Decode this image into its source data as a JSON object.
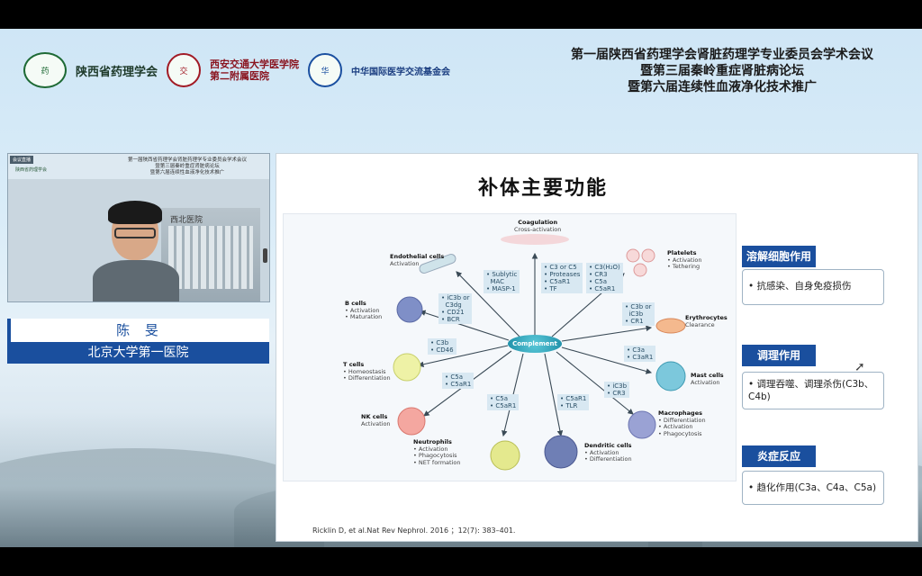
{
  "header": {
    "logos": [
      {
        "icon": "pharmacology-society-logo",
        "name": "陕西省药理学会"
      },
      {
        "icon": "xjtu-medical-logo",
        "name_line1": "西安交通大学医学院",
        "name_line2": "第二附属医院"
      },
      {
        "icon": "china-medical-exchange-logo",
        "name": "中华国际医学交流基金会"
      }
    ],
    "conference_lines": [
      "第一届陕西省药理学会肾脏药理学专业委员会学术会议",
      "暨第三届秦岭重症肾脏病论坛",
      "暨第六届连续性血液净化技术推广"
    ]
  },
  "video": {
    "badge": "会议直播",
    "title_lines": [
      "第一届陕西省药理学会肾脏药理学专业委员会学术会议",
      "暨第三届秦岭重症肾脏病论坛",
      "暨第六届连续性血液净化技术推广"
    ],
    "logo_text": "陕西省药理学会",
    "building_text": "西北医院"
  },
  "speaker": {
    "name": "陈 旻",
    "hospital": "北京大学第一医院"
  },
  "slide": {
    "title": "补体主要功能",
    "citation": "Ricklin D, et al.Nat Rev Nephrol. 2016 ；12(7): 383–401.",
    "functions": [
      {
        "heading": "溶解细胞作用",
        "text": "• 抗感染、自身免疫损伤"
      },
      {
        "heading": "调理作用",
        "text": "• 调理吞噬、调理杀伤(C3b、C4b)"
      },
      {
        "heading": "炎症反应",
        "text": "• 趋化作用(C3a、C4a、C5a)"
      }
    ],
    "diagram": {
      "center": "Complement",
      "cells": [
        {
          "title": "Coagulation",
          "sub": "Cross-activation"
        },
        {
          "title": "Endothelial cells",
          "sub": "Activation"
        },
        {
          "title": "Platelets",
          "sub": "• Activation\n• Tethering"
        },
        {
          "title": "B cells",
          "sub": "• Activation\n• Maturation"
        },
        {
          "title": "Erythrocytes",
          "sub": "Clearance"
        },
        {
          "title": "T cells",
          "sub": "• Homeostasis\n• Differentiation"
        },
        {
          "title": "Mast cells",
          "sub": "Activation"
        },
        {
          "title": "NK cells",
          "sub": "Activation"
        },
        {
          "title": "Macrophages",
          "sub": "• Differentiation\n• Activation\n• Phagocytosis"
        },
        {
          "title": "Neutrophils",
          "sub": "• Activation\n• Phagocytosis\n• NET formation"
        },
        {
          "title": "Dendritic cells",
          "sub": "• Activation\n• Differentiation"
        }
      ],
      "tags": [
        "• Sublytic\n  MAC\n• MASP-1",
        "• C3 or C5\n• Proteases\n• C5aR1\n• TF",
        "• C3(H₂O)\n• CR3\n• C5a\n• C5aR1",
        "• iC3b or\n  C3dg\n• CD21\n• BCR",
        "• C3b or\n  iC3b\n• CR1",
        "• C3b\n• CD46",
        "• C3a\n• C3aR1",
        "• C5a\n• C5aR1",
        "• iC3b\n• CR3",
        "• C5a\n• C5aR1",
        "• C5aR1\n• TLR"
      ]
    }
  }
}
